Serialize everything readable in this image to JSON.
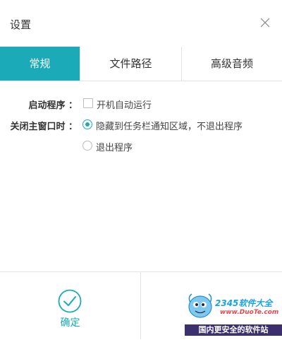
{
  "window": {
    "title": "设置",
    "close_icon": "close-icon"
  },
  "tabs": [
    {
      "label": "常规",
      "active": true
    },
    {
      "label": "文件路径",
      "active": false
    },
    {
      "label": "高级音频",
      "active": false
    }
  ],
  "general": {
    "startup_label": "启动程序 ：",
    "startup_option": {
      "label": "开机自动运行",
      "checked": false
    },
    "close_label": "关闭主窗口时 ：",
    "close_options": [
      {
        "label": "隐藏到任务栏通知区域，不退出程序",
        "selected": true
      },
      {
        "label": "退出程序",
        "selected": false
      }
    ]
  },
  "footer": {
    "ok_label": "确定",
    "ok_icon": "check-circle-icon"
  },
  "watermark": {
    "brand": "2345软件大全",
    "url": "www.DuoTe.com",
    "banner": "国内更安全的软件站"
  },
  "colors": {
    "accent": "#1aaab8",
    "banner": "#3b2f6e"
  }
}
